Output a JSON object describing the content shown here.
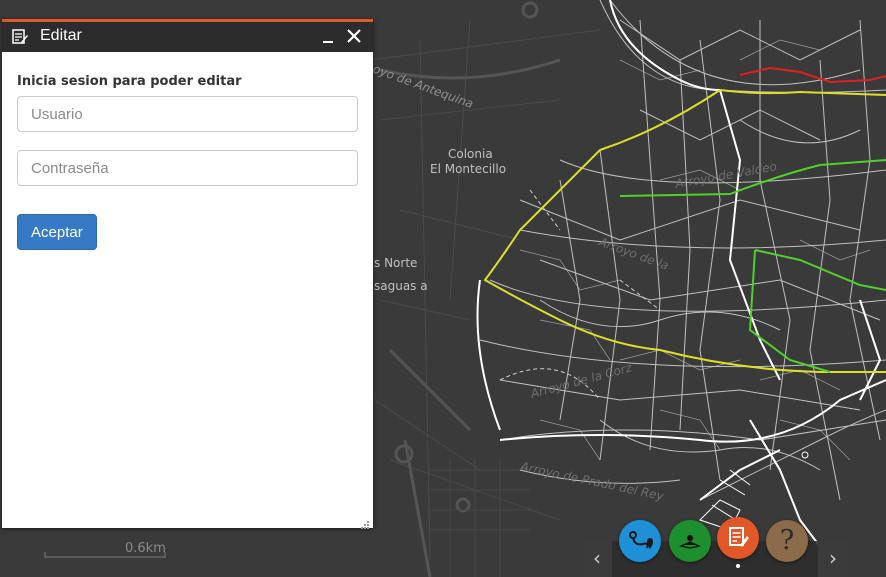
{
  "map": {
    "labels": {
      "arroyo_antequina": "oyo de Antequina",
      "colonia": "Colonia",
      "el_montecillo": "El Montecillo",
      "norte": "s Norte",
      "saguas": "saguas a",
      "arroyo_valdeo": "Arroyo de Valdeo",
      "arroyo_de_la": "Arroyo de la",
      "arroyo_de_la_corz": "Arroyo de la Corz",
      "arroyo_prado_rey": "Arroyo de Prado del Rey"
    },
    "scale_label": "0.6km"
  },
  "panel": {
    "title": "Editar",
    "icon": "edit-document-icon",
    "heading": "Inicia sesion para poder editar",
    "username_placeholder": "Usuario",
    "password_placeholder": "Contraseña",
    "accept_label": "Aceptar"
  },
  "toolbar": {
    "tools": [
      {
        "name": "route",
        "icon": "route-pin-icon",
        "color": "#1f8fd6"
      },
      {
        "name": "layers",
        "icon": "person-marker-icon",
        "color": "#1e8f2f"
      },
      {
        "name": "edit",
        "icon": "edit-document-icon",
        "color": "#e0582a"
      },
      {
        "name": "help",
        "icon": "question-icon",
        "label": "?",
        "color": "#8b6b4a"
      }
    ]
  },
  "colors": {
    "panel_accent": "#e0582a",
    "header_bg": "#2c2c2c",
    "button_blue": "#3679c4",
    "map_bg": "#3a3a3a"
  }
}
